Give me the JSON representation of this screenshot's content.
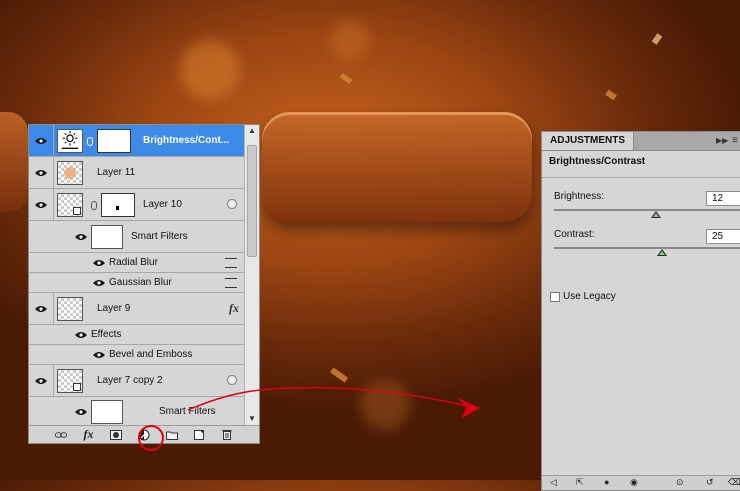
{
  "layers": {
    "rows": [
      {
        "name": "Brightness/Cont..."
      },
      {
        "name": "Layer 11"
      },
      {
        "name": "Layer 10"
      },
      {
        "name": "Smart Filters"
      },
      {
        "name": "Radial Blur"
      },
      {
        "name": "Gaussian Blur"
      },
      {
        "name": "Layer 9"
      },
      {
        "name": "Effects"
      },
      {
        "name": "Bevel and Emboss"
      },
      {
        "name": "Layer 7 copy 2"
      },
      {
        "name": "Smart Filters"
      }
    ],
    "fx_badge": "fx",
    "toolbar_fx": "fx"
  },
  "adjustments": {
    "tab": "ADJUSTMENTS",
    "title": "Brightness/Contrast",
    "brightness_label": "Brightness:",
    "brightness_value": "12",
    "contrast_label": "Contrast:",
    "contrast_value": "25",
    "legacy_label": "Use Legacy",
    "legacy_checked": false,
    "brightness_slider": 0.512,
    "contrast_slider": 0.542
  },
  "colors": {
    "selection": "#3d8ae8",
    "panel": "#d6d6d6",
    "annotation": "#e00010"
  },
  "icons": [
    "eye-icon",
    "link-icon",
    "fx-icon",
    "layer-options-icon",
    "filter-settings-icon",
    "mask-icon",
    "adjustment-layer-icon",
    "folder-icon",
    "new-layer-icon",
    "trash-icon"
  ]
}
